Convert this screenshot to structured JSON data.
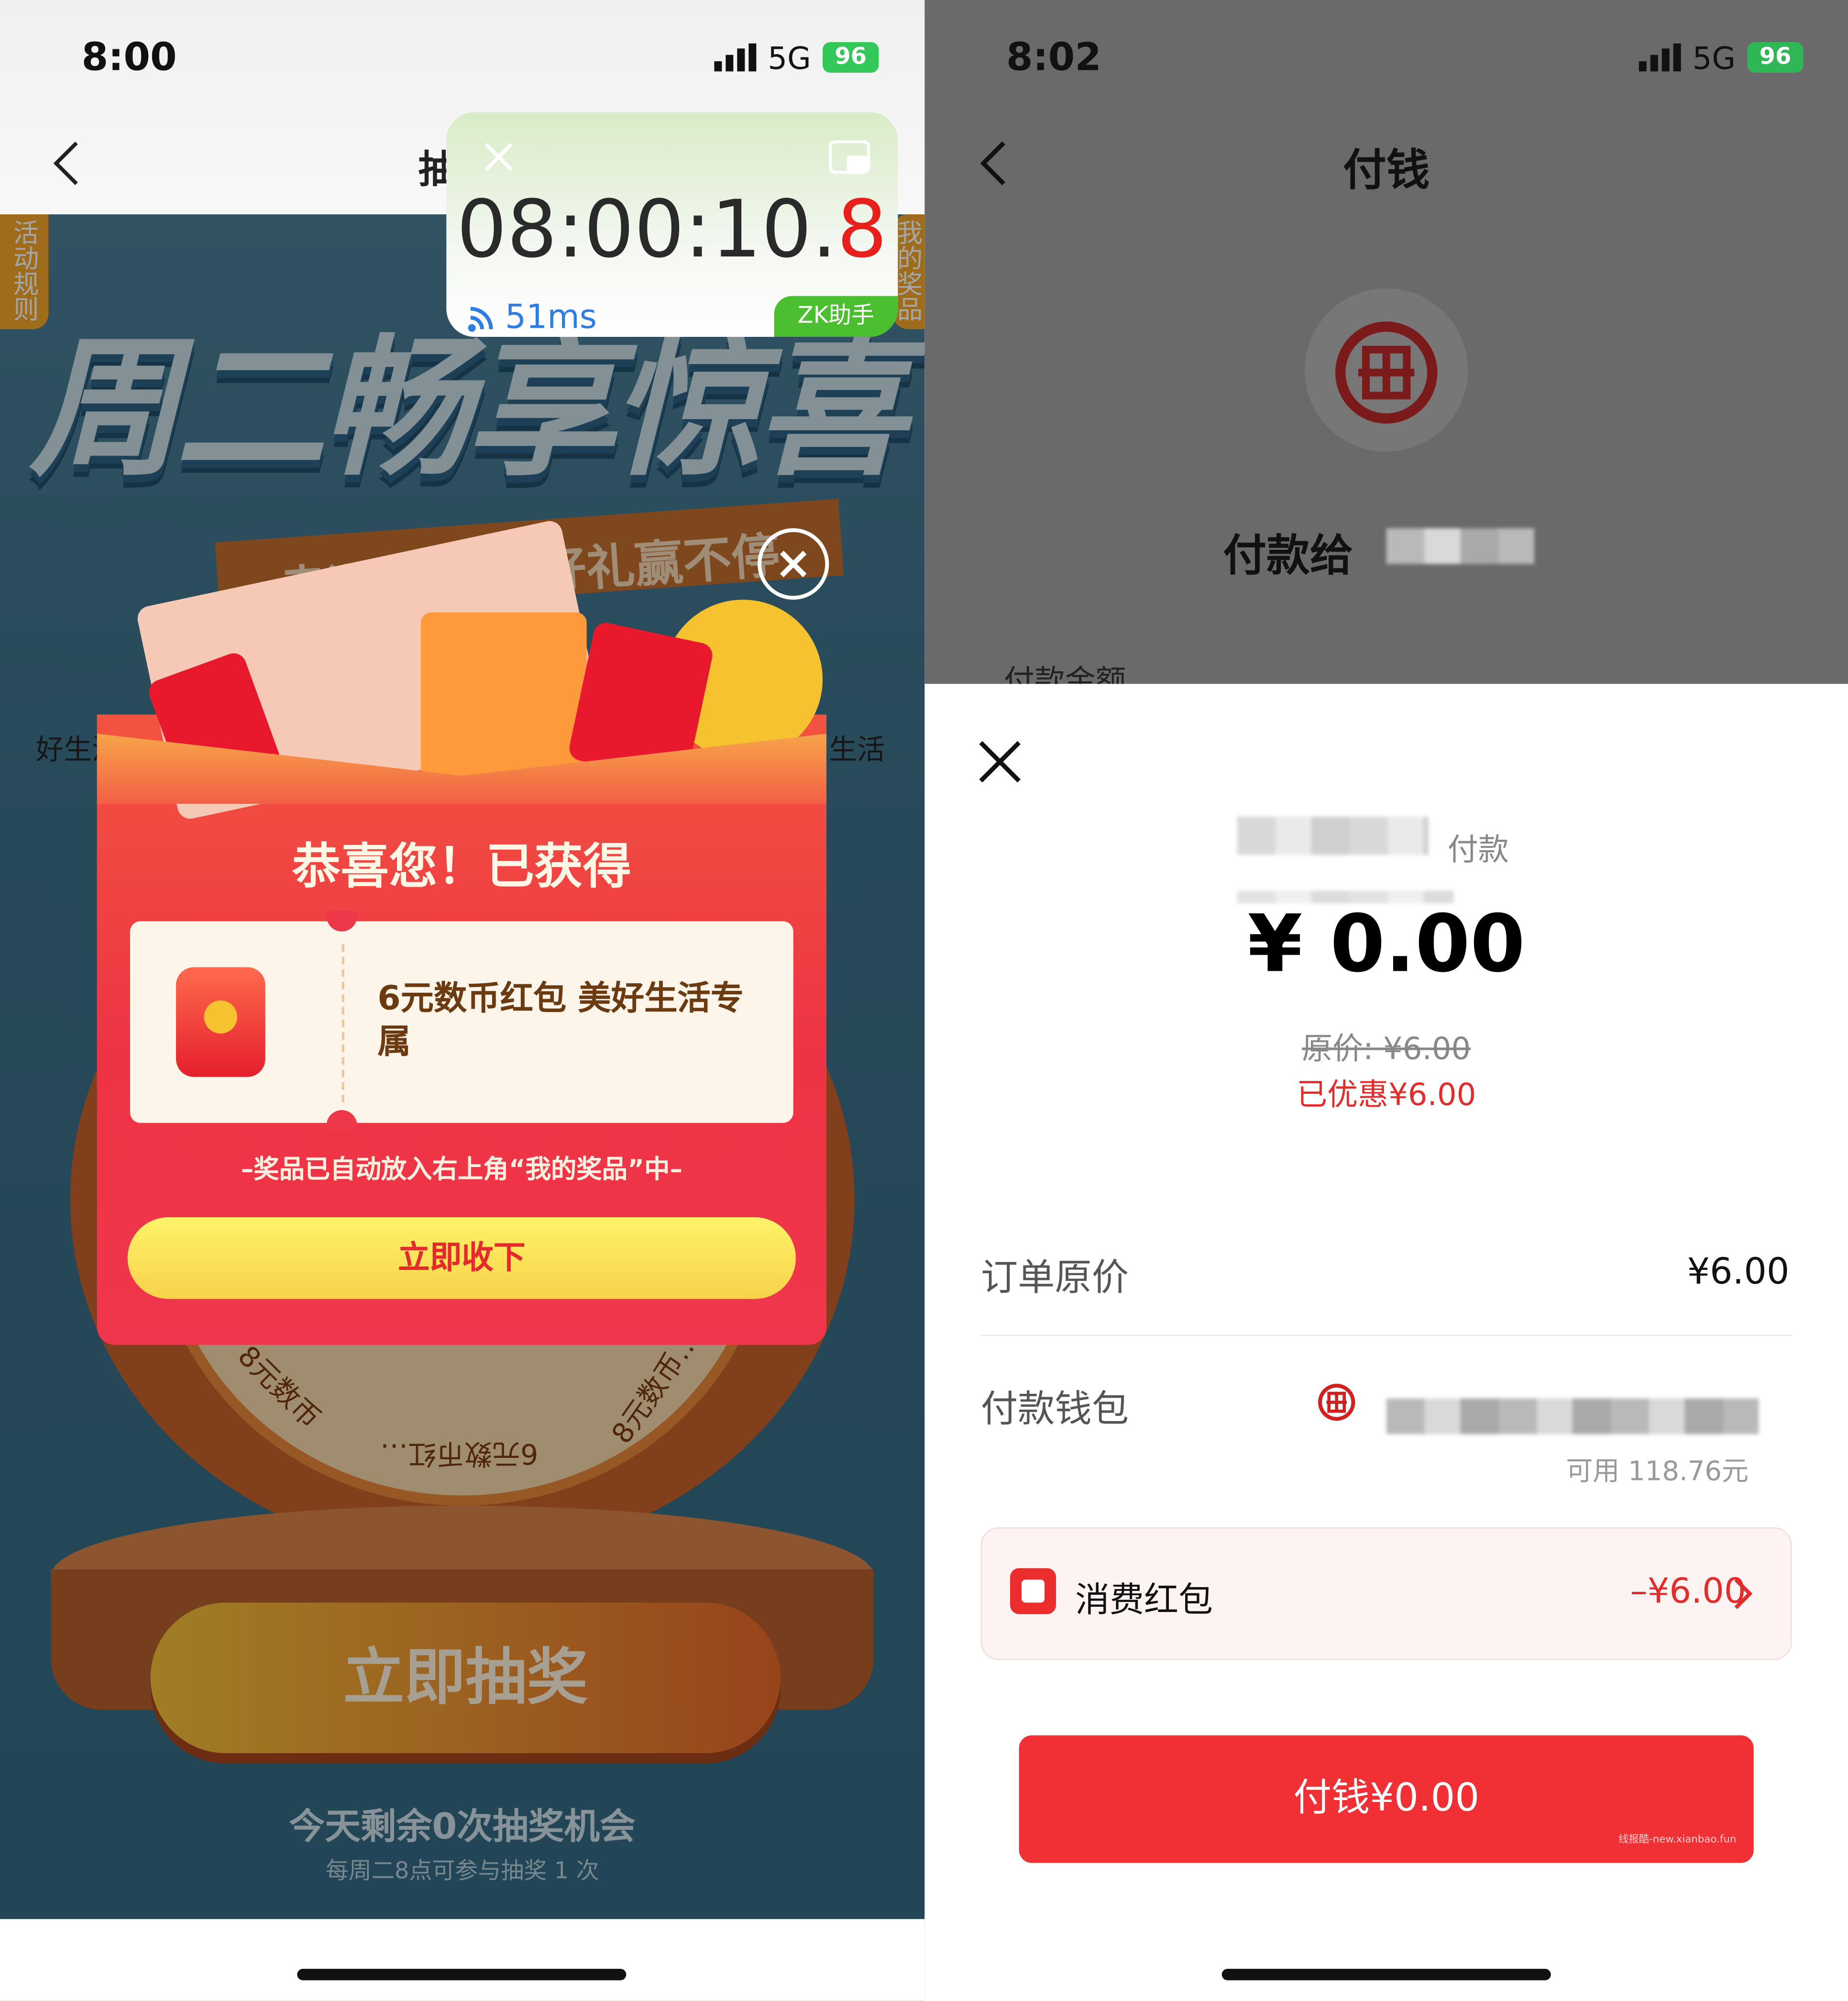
{
  "left": {
    "status": {
      "time": "8:00",
      "network": "5G",
      "battery": "96"
    },
    "nav": {
      "title_partial": "抽"
    },
    "timer_widget": {
      "time_main": "08:00:10.",
      "time_last": "8",
      "latency": "51ms",
      "brand": "ZK助手"
    },
    "side_tags": {
      "rules": "活动规则",
      "prizes": "我的奖品"
    },
    "banner": {
      "title": "周二畅享惊喜",
      "subtitle": "幸运大转盘 好礼赢不停"
    },
    "wheel_labels": [
      "好生活",
      "生活",
      "8元数币",
      "6元数币红…",
      "8元数币…"
    ],
    "modal": {
      "heading": "恭喜您！已获得",
      "prize_name": "6元数币红包 美好生活专属",
      "note": "–奖品已自动放入右上角“我的奖品”中–",
      "accept_button": "立即收下"
    },
    "draw_button": "立即抽奖",
    "remaining": "今天剩余0次抽奖机会",
    "rule_line": "每周二8点可参与抽奖 1 次"
  },
  "right": {
    "status": {
      "time": "8:02",
      "network": "5G",
      "battery": "96"
    },
    "nav": {
      "title": "付钱"
    },
    "pay_to_label": "付款给",
    "amount_label_partial": "付款金额",
    "sheet": {
      "payee_suffix": "付款",
      "amount": "¥ 0.00",
      "original_price": "原价: ¥6.00",
      "discount": "已优惠¥6.00",
      "order_price_label": "订单原价",
      "order_price_value": "¥6.00",
      "wallet_label": "付款钱包",
      "wallet_available": "可用 118.76元",
      "coupon_label": "消费红包",
      "coupon_value": "–¥6.00",
      "pay_button": "付钱¥0.00",
      "watermark": "线报酷-new.xianbao.fun"
    }
  },
  "colors": {
    "accent_red": "#f03035",
    "timer_green": "#dff0d0",
    "gold": "#ffd23c",
    "coupon_red": "#e32d2d"
  }
}
